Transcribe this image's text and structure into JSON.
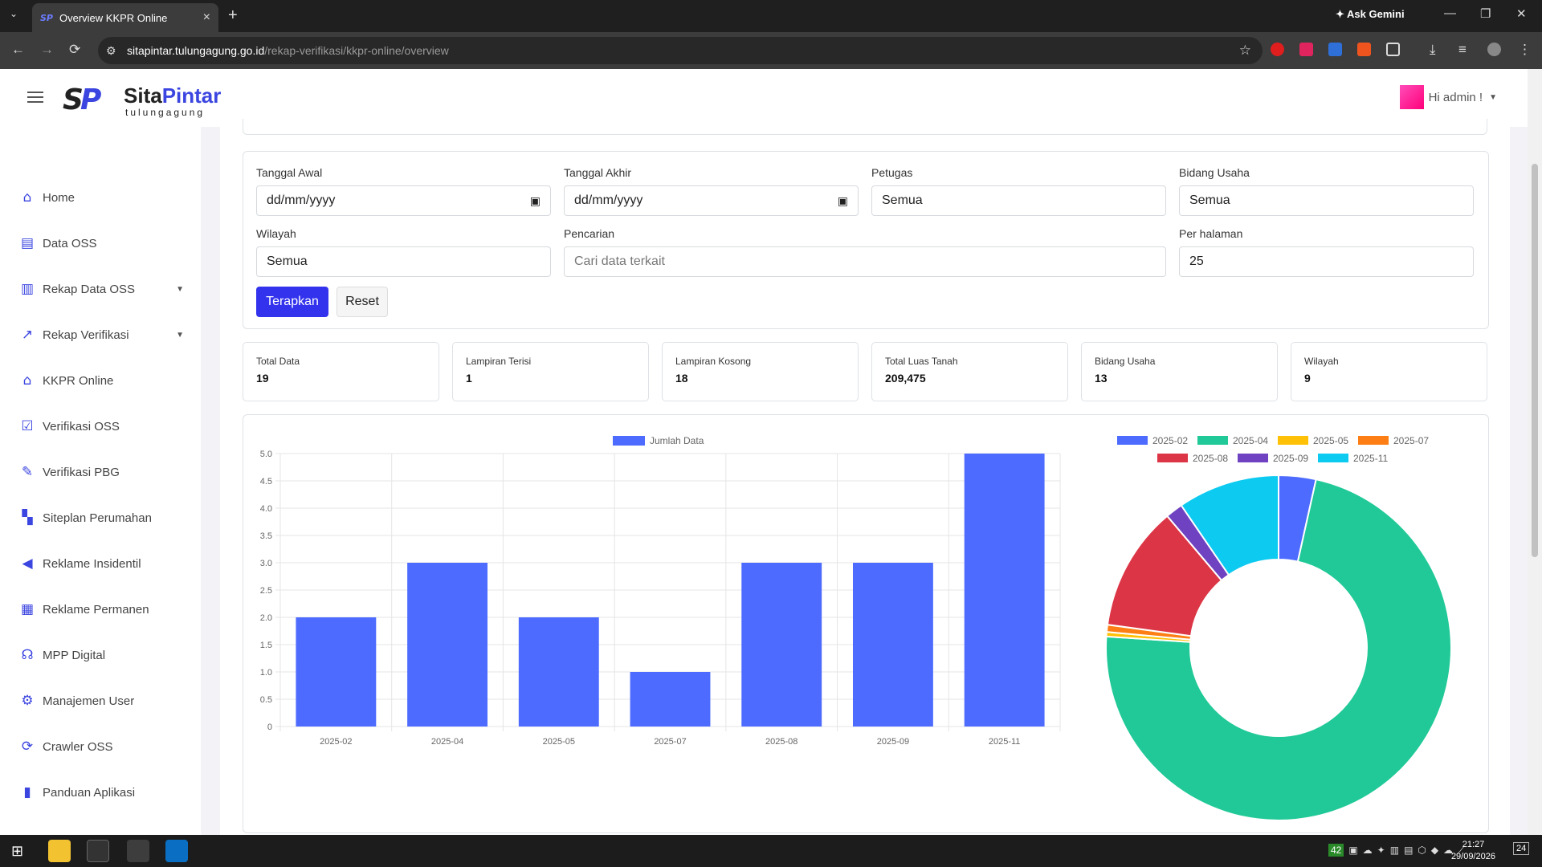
{
  "browser": {
    "tab_title": "Overview KKPR Online",
    "tab_favicon": "SP",
    "ask_gemini": "Ask Gemini",
    "url_host": "sitapintar.tulungagung.go.id",
    "url_path": "/rekap-verifikasi/kkpr-online/overview"
  },
  "header": {
    "logo_mark": "SP",
    "logo_name_a": "Sita",
    "logo_name_b": "Pintar",
    "logo_sub": "tulungagung",
    "user_greeting": "Hi admin !"
  },
  "sidebar": {
    "items": [
      {
        "label": "Home",
        "icon": "home-icon",
        "glyph": "⌂"
      },
      {
        "label": "Data OSS",
        "icon": "archive-icon",
        "glyph": "▤"
      },
      {
        "label": "Rekap Data OSS",
        "icon": "bar-chart-icon",
        "glyph": "▥",
        "caret": "▼"
      },
      {
        "label": "Rekap Verifikasi",
        "icon": "line-chart-icon",
        "glyph": "↗",
        "caret": "▼"
      },
      {
        "label": "KKPR Online",
        "icon": "bank-icon",
        "glyph": "⌂"
      },
      {
        "label": "Verifikasi OSS",
        "icon": "check-square-icon",
        "glyph": "☑"
      },
      {
        "label": "Verifikasi PBG",
        "icon": "edit-icon",
        "glyph": "✎"
      },
      {
        "label": "Siteplan Perumahan",
        "icon": "map-icon",
        "glyph": "▚"
      },
      {
        "label": "Reklame Insidentil",
        "icon": "bullhorn-icon",
        "glyph": "◀"
      },
      {
        "label": "Reklame Permanen",
        "icon": "building-icon",
        "glyph": "▦"
      },
      {
        "label": "MPP Digital",
        "icon": "stethoscope-icon",
        "glyph": "☊"
      },
      {
        "label": "Manajemen User",
        "icon": "gear-icon",
        "glyph": "⚙"
      },
      {
        "label": "Crawler OSS",
        "icon": "sync-icon",
        "glyph": "⟳"
      },
      {
        "label": "Panduan Aplikasi",
        "icon": "book-icon",
        "glyph": "▮"
      }
    ]
  },
  "filters": {
    "tanggal_awal": {
      "label": "Tanggal Awal",
      "value": "dd/mm/yyyy"
    },
    "tanggal_akhir": {
      "label": "Tanggal Akhir",
      "value": "dd/mm/yyyy"
    },
    "petugas": {
      "label": "Petugas",
      "value": "Semua"
    },
    "bidang_usaha": {
      "label": "Bidang Usaha",
      "value": "Semua"
    },
    "wilayah": {
      "label": "Wilayah",
      "value": "Semua"
    },
    "pencarian": {
      "label": "Pencarian",
      "placeholder": "Cari data terkait"
    },
    "per_halaman": {
      "label": "Per halaman",
      "value": "25"
    },
    "apply_label": "Terapkan",
    "reset_label": "Reset"
  },
  "stats": [
    {
      "label": "Total Data",
      "value": "19"
    },
    {
      "label": "Lampiran Terisi",
      "value": "1"
    },
    {
      "label": "Lampiran Kosong",
      "value": "18"
    },
    {
      "label": "Total Luas Tanah",
      "value": "209,475"
    },
    {
      "label": "Bidang Usaha",
      "value": "13"
    },
    {
      "label": "Wilayah",
      "value": "9"
    }
  ],
  "chart_data": [
    {
      "type": "bar",
      "legend": "Jumlah Data",
      "color": "#4d6bfe",
      "categories": [
        "2025-02",
        "2025-04",
        "2025-05",
        "2025-07",
        "2025-08",
        "2025-09",
        "2025-11"
      ],
      "values": [
        2,
        3,
        2,
        1,
        3,
        3,
        5
      ],
      "ylim": [
        0,
        5
      ],
      "yticks": [
        "0",
        "0.5",
        "1.0",
        "1.5",
        "2.0",
        "2.5",
        "3.0",
        "3.5",
        "4.0",
        "4.5",
        "5.0"
      ],
      "grid": true,
      "legend_position": "top"
    },
    {
      "type": "pie",
      "donut": true,
      "legend_position": "top",
      "labels": [
        "2025-02",
        "2025-04",
        "2025-05",
        "2025-07",
        "2025-08",
        "2025-09",
        "2025-11"
      ],
      "values": [
        7300,
        152000,
        900,
        1400,
        24500,
        3400,
        19975
      ],
      "colors": [
        "#4d6bfe",
        "#20c997",
        "#ffc107",
        "#fd7e14",
        "#dc3545",
        "#6f42c1",
        "#0dcaf0"
      ]
    }
  ],
  "taskbar": {
    "time": "21:27",
    "date": "29/09/2026",
    "notif_count": "24",
    "tray_number": "42"
  }
}
